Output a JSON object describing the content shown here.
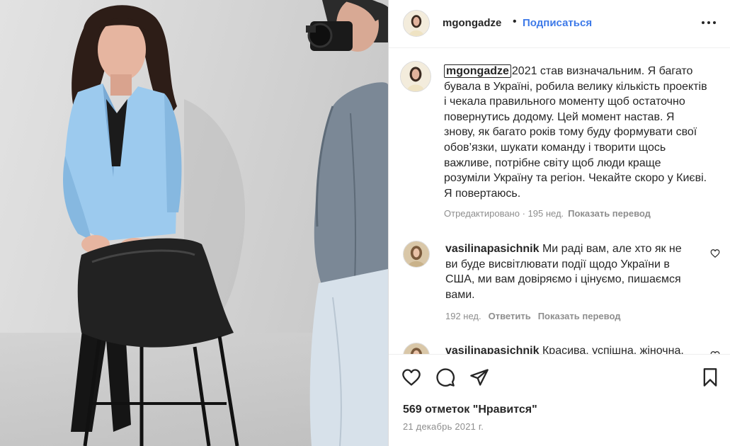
{
  "post": {
    "username": "mgongadze",
    "follow_label": "Подписаться",
    "more_icon": "more-horizontal-icon"
  },
  "caption": {
    "username": "mgongadze",
    "text": "2021 став визначальним. Я багато бувала в Україні, робила велику кількість проектів і чекала правильного моменту щоб остаточно повернутись додому. Цей момент настав. Я знову, як багато років тому буду формувати свої обов’язки, шукати команду і творити щось важливе, потрібне світу щоб люди краще розуміли Україну та регіон. Чекайте скоро у Києві. Я повертаюсь.",
    "edited": "Отредактировано · 195 нед.",
    "translate": "Показать перевод"
  },
  "comments": [
    {
      "username": "vasilinapasichnik",
      "text": "Ми раді вам, але хто як не ви буде висвітлювати події щодо України в США, ми вам довіряємо і цінуємо, пишаємся вами.",
      "time": "192 нед.",
      "reply": "Ответить",
      "translate": "Показать перевод"
    },
    {
      "username": "vasilinapasichnik",
      "text": "Красива, успішна, жіночна."
    }
  ],
  "actions": {
    "like_icon": "heart-icon",
    "comment_icon": "comment-icon",
    "share_icon": "paper-plane-icon",
    "save_icon": "bookmark-icon"
  },
  "likes": "569 отметок \"Нравится\"",
  "date": "21 декабрь 2021 г.",
  "colors": {
    "follow": "#3e7ae8",
    "meta": "#8e8e8e",
    "text": "#262626",
    "jacket": "#9ccaee"
  }
}
